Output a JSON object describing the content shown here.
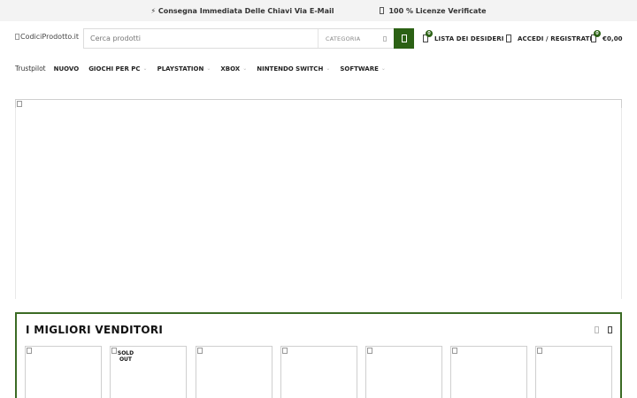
{
  "topbar": {
    "delivery": "⚡ Consegna Immediata Delle Chiavi Via E-Mail",
    "licenses": "100 % Licenze Verificate",
    "licenses_icon": "check-shield-icon"
  },
  "header": {
    "logo_alt": "CodiciProdotto.it",
    "search_placeholder": "Cerca prodotti",
    "category_label": "CATEGORIA",
    "wishlist_label": "LISTA DEI DESIDERI",
    "wishlist_count": "0",
    "account_label": "ACCEDI / REGISTRATI",
    "cart_total": "€0,00",
    "cart_count": "0",
    "accent_color": "#2b6114"
  },
  "nav": {
    "trust_label": "Trustpilot",
    "items": [
      {
        "label": "NUOVO"
      },
      {
        "label": "GIOCHI PER PC"
      },
      {
        "label": "PLAYSTATION"
      },
      {
        "label": "XBOX"
      },
      {
        "label": "NINTENDO SWITCH"
      },
      {
        "label": "SOFTWARE"
      }
    ]
  },
  "bestsellers": {
    "title": "I MIGLIORI VENDITORI",
    "sold_out_label": "SOLD OUT",
    "border_color": "#3b6b24"
  }
}
